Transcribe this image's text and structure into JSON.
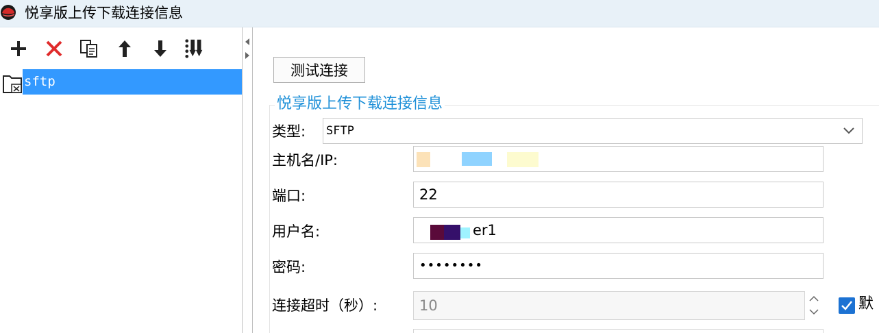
{
  "window": {
    "title": "悦享版上传下载连接信息",
    "icon": "redhat-icon"
  },
  "toolbar": {
    "buttons": [
      {
        "name": "add",
        "icon": "plus-icon"
      },
      {
        "name": "delete",
        "icon": "delete-x-icon"
      },
      {
        "name": "copy",
        "icon": "copy-icon"
      },
      {
        "name": "move-up",
        "icon": "arrow-up-icon"
      },
      {
        "name": "move-down",
        "icon": "arrow-down-icon"
      },
      {
        "name": "sort",
        "icon": "sort-icon"
      }
    ]
  },
  "tree": {
    "items": [
      {
        "label": "sftp",
        "selected": true,
        "icon": "folder-icon"
      }
    ]
  },
  "form": {
    "test_button": "测试连接",
    "group_title": "悦享版上传下载连接信息",
    "type_label": "类型:",
    "type_value": "SFTP",
    "host_label": "主机名/IP:",
    "host_value": "",
    "port_label": "端口:",
    "port_value": "22",
    "user_label": "用户名:",
    "user_value_suffix": "er1",
    "password_label": "密码:",
    "password_value": "••••••••",
    "timeout_label": "连接超时（秒）:",
    "timeout_value": "10",
    "default_checkbox_label": "默",
    "default_checked": true
  },
  "colors": {
    "selection": "#3399ff",
    "group_title": "#1e90d8",
    "delete_red": "#e02b2b",
    "checkbox": "#1c72d3"
  }
}
